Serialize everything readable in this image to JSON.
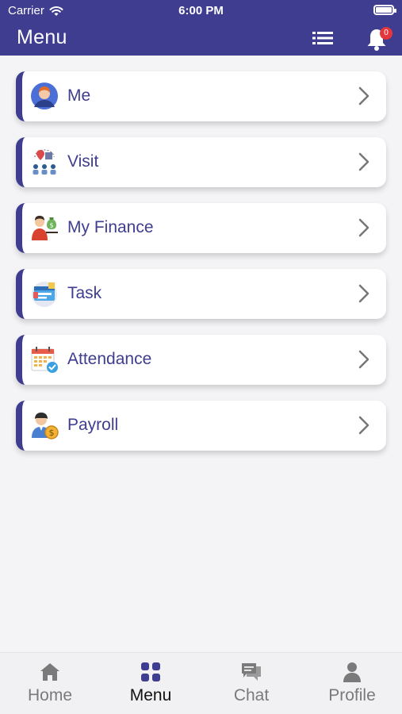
{
  "status_bar": {
    "carrier": "Carrier",
    "time": "6:00 PM",
    "battery_level": 1.0
  },
  "header": {
    "title": "Menu",
    "notification_count": "0",
    "list_icon": "list-icon",
    "bell_icon": "bell-icon"
  },
  "menu": {
    "items": [
      {
        "label": "Me",
        "icon": "person-avatar-icon"
      },
      {
        "label": "Visit",
        "icon": "visit-location-icon"
      },
      {
        "label": "My Finance",
        "icon": "finance-money-bag-icon"
      },
      {
        "label": "Task",
        "icon": "task-board-icon"
      },
      {
        "label": "Attendance",
        "icon": "attendance-calendar-icon"
      },
      {
        "label": "Payroll",
        "icon": "payroll-coin-icon"
      }
    ]
  },
  "bottom_nav": {
    "tabs": [
      {
        "label": "Home",
        "icon": "home-icon",
        "active": false
      },
      {
        "label": "Menu",
        "icon": "grid-menu-icon",
        "active": true
      },
      {
        "label": "Chat",
        "icon": "chat-icon",
        "active": false
      },
      {
        "label": "Profile",
        "icon": "profile-icon",
        "active": false
      }
    ]
  },
  "colors": {
    "primary": "#3f3d8f",
    "badge": "#e4373d",
    "background": "#f4f4f6",
    "nav_inactive": "#7a7a7a",
    "nav_active": "#111111"
  }
}
